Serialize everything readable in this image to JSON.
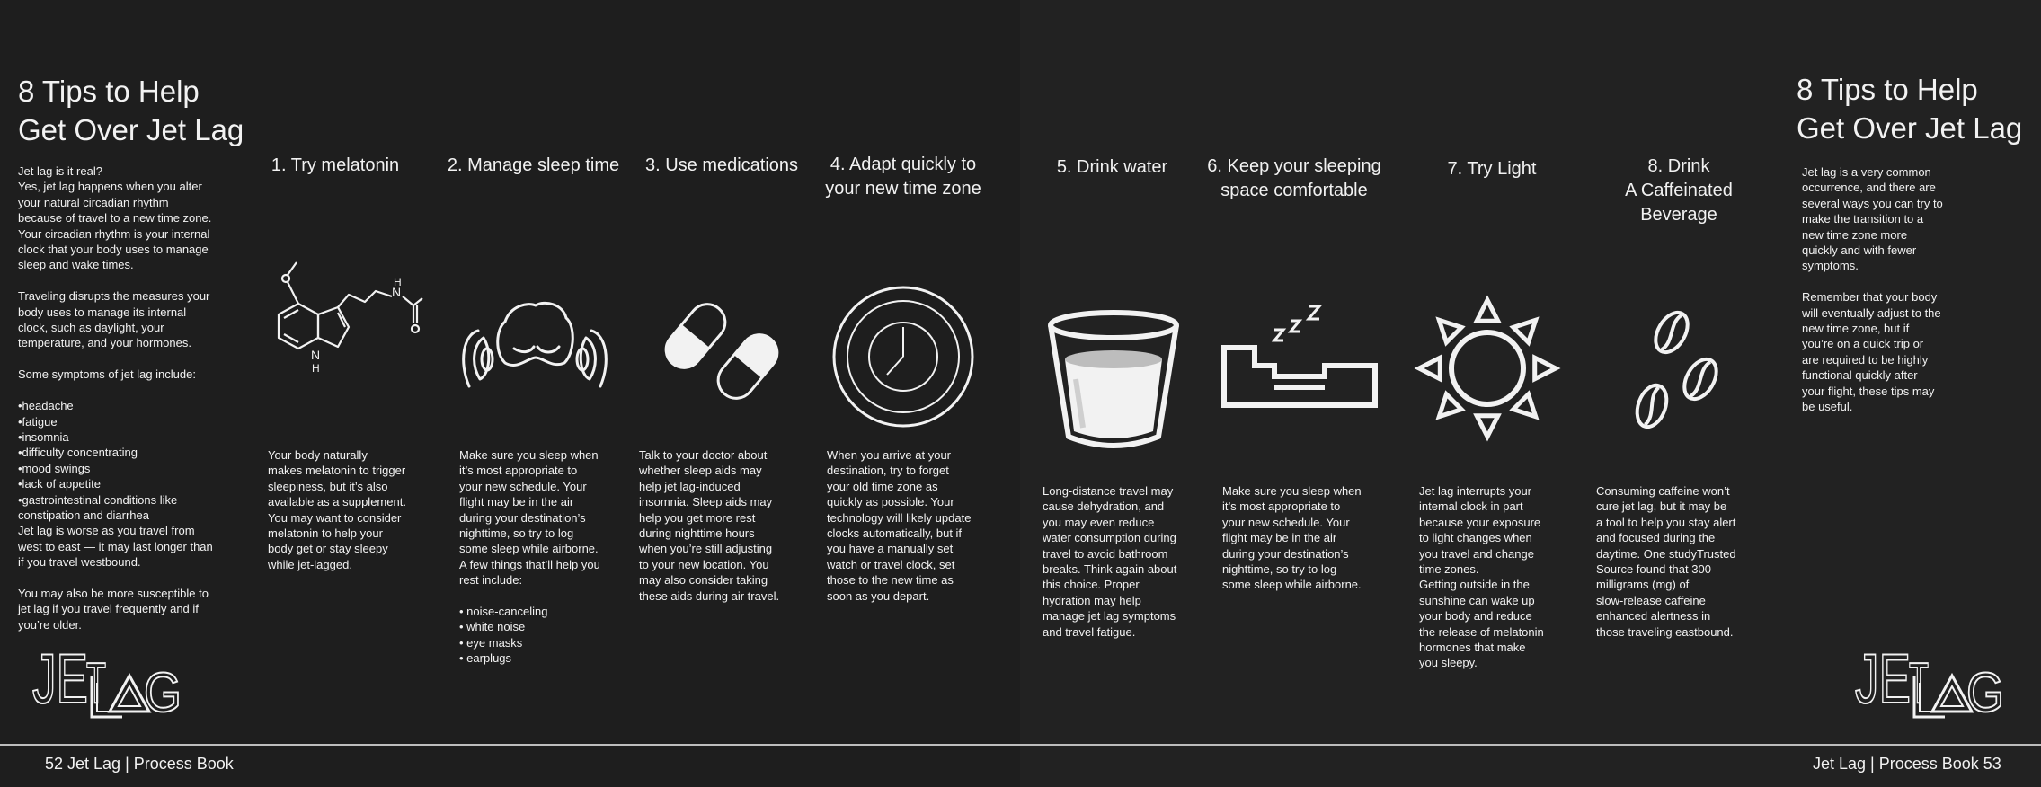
{
  "left_page": {
    "title_line1": "8 Tips to Help",
    "title_line2": "Get Over Jet Lag",
    "intro_text": "Jet lag is it real?\nYes, jet lag happens when you alter\nyour natural circadian rhythm\nbecause of travel to a new time zone.\nYour circadian rhythm is your internal\nclock that your body uses to manage\nsleep and wake times.\n\nTraveling disrupts the measures your\nbody uses to manage its internal\nclock, such as daylight, your\ntemperature, and your hormones.\n\nSome symptoms of jet lag include:\n\n•headache\n•fatigue\n•insomnia\n•difficulty concentrating\n•mood swings\n•lack of appetite\n•gastrointestinal conditions like\nconstipation and diarrhea\nJet lag is worse as you travel from\nwest to east — it may last longer than\nif you travel westbound.\n\nYou may also be more susceptible to\njet lag if you travel frequently and if\nyou’re older.",
    "logo_text": "JETLAG",
    "footer": "52  Jet Lag | Process Book"
  },
  "tips": [
    {
      "title": "1.  Try melatonin",
      "icon": "melatonin-molecule-icon",
      "text": "Your body naturally\nmakes melatonin to trigger\nsleepiness, but it’s also\navailable as a supplement.\nYou may want to consider\nmelatonin to help your\nbody get or stay sleepy\nwhile jet-lagged."
    },
    {
      "title": "2. Manage sleep time",
      "icon": "sleep-mask-icon",
      "text": "Make sure you sleep when\nit’s most appropriate to\nyour new schedule. Your\nflight may be in the air\nduring your destination’s\nnighttime, so try to log\nsome sleep while airborne.\nA few things that’ll help you\nrest include:\n\n• noise-canceling\n• white noise\n• eye masks\n• earplugs"
    },
    {
      "title": "3. Use medications",
      "icon": "pills-icon",
      "text": "Talk to your doctor about\nwhether sleep aids may\nhelp jet lag-induced\ninsomnia. Sleep aids may\nhelp you get more rest\nduring nighttime hours\nwhen you’re still adjusting\nto your new location. You\nmay also consider taking\nthese aids during air travel."
    },
    {
      "title": "4. Adapt quickly to\nyour new time zone",
      "icon": "clock-icon",
      "text": "When you arrive at your\ndestination, try to forget\nyour old time zone as\nquickly as possible. Your\ntechnology will likely update\nclocks automatically, but if\nyou have a manually set\nwatch or travel clock, set\nthose to the new time as\nsoon as you depart."
    },
    {
      "title": "5. Drink water",
      "icon": "water-glass-icon",
      "text": "Long-distance travel may\ncause dehydration, and\nyou may even reduce\nwater consumption during\ntravel to avoid bathroom\nbreaks. Think again about\nthis choice. Proper\nhydration may help\nmanage jet lag symptoms\nand travel fatigue."
    },
    {
      "title": "6. Keep your sleeping\nspace comfortable",
      "icon": "bed-zzz-icon",
      "text": "Make sure you sleep when\nit’s most appropriate to\nyour new schedule. Your\nflight may be in the air\nduring your destination’s\nnighttime, so try to log\nsome sleep while airborne."
    },
    {
      "title": "7. Try Light",
      "icon": "sun-icon",
      "text": "Jet lag interrupts your\ninternal clock in part\nbecause your exposure\nto light changes when\nyou travel and change\ntime zones.\nGetting outside in the\nsunshine can wake up\nyour body and reduce\nthe release of melatonin\nhormones that make\nyou sleepy."
    },
    {
      "title": "8. Drink\nA Caffeinated\nBeverage",
      "icon": "coffee-beans-icon",
      "text": "Consuming caffeine won’t\ncure jet lag, but it may be\na tool to help you stay alert\nand focused during the\ndaytime. One studyTrusted\nSource found that 300\nmilligrams (mg) of\nslow-release caffeine\nenhanced alertness in\nthose traveling eastbound."
    }
  ],
  "right_page": {
    "title_line1": "8 Tips to Help",
    "title_line2": "Get Over Jet Lag",
    "intro_text": "Jet lag is a very common\noccurrence, and there are\nseveral ways you can try to\nmake the transition to a\nnew time zone more\nquickly and with fewer\nsymptoms.\n\nRemember that your body\nwill eventually adjust to the\nnew time zone, but if\nyou’re on a quick trip or\nare required to be highly\nfunctional quickly after\nyour flight, these tips may\nbe useful.",
    "logo_text": "JETLAG",
    "footer": "Jet Lag | Process Book 53"
  },
  "colors": {
    "background_left": "#1e1e1e",
    "background_right": "#222222",
    "text": "#f2f2f2",
    "rule": "#bdbdbd"
  }
}
